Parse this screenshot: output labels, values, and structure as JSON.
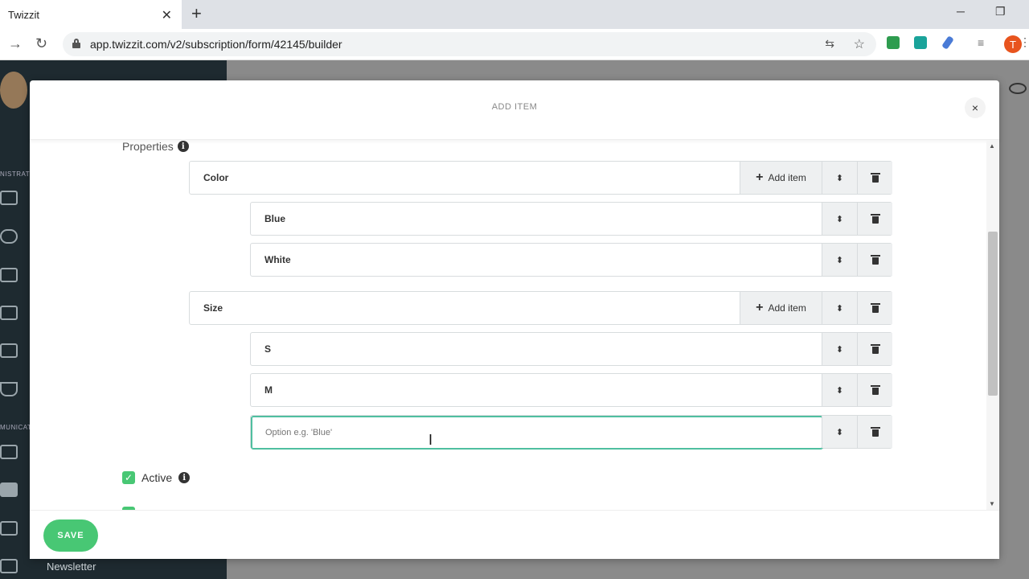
{
  "browser": {
    "tab_title": "Twizzit",
    "url": "app.twizzit.com/v2/subscription/form/42145/builder",
    "profile_initial": "T"
  },
  "sidebar": {
    "section1": "NISTRATI",
    "section2": "MUNICATI",
    "newsletter": "Newsletter"
  },
  "modal": {
    "title": "ADD ITEM",
    "close_label": "×",
    "properties_label": "Properties",
    "add_item_label": "Add item",
    "properties": [
      {
        "name": "Color",
        "options": [
          "Blue",
          "White"
        ]
      },
      {
        "name": "Size",
        "options": [
          "S",
          "M"
        ]
      }
    ],
    "option_placeholder": "Option e.g. 'Blue'",
    "active_label": "Active",
    "save_label": "SAVE"
  }
}
